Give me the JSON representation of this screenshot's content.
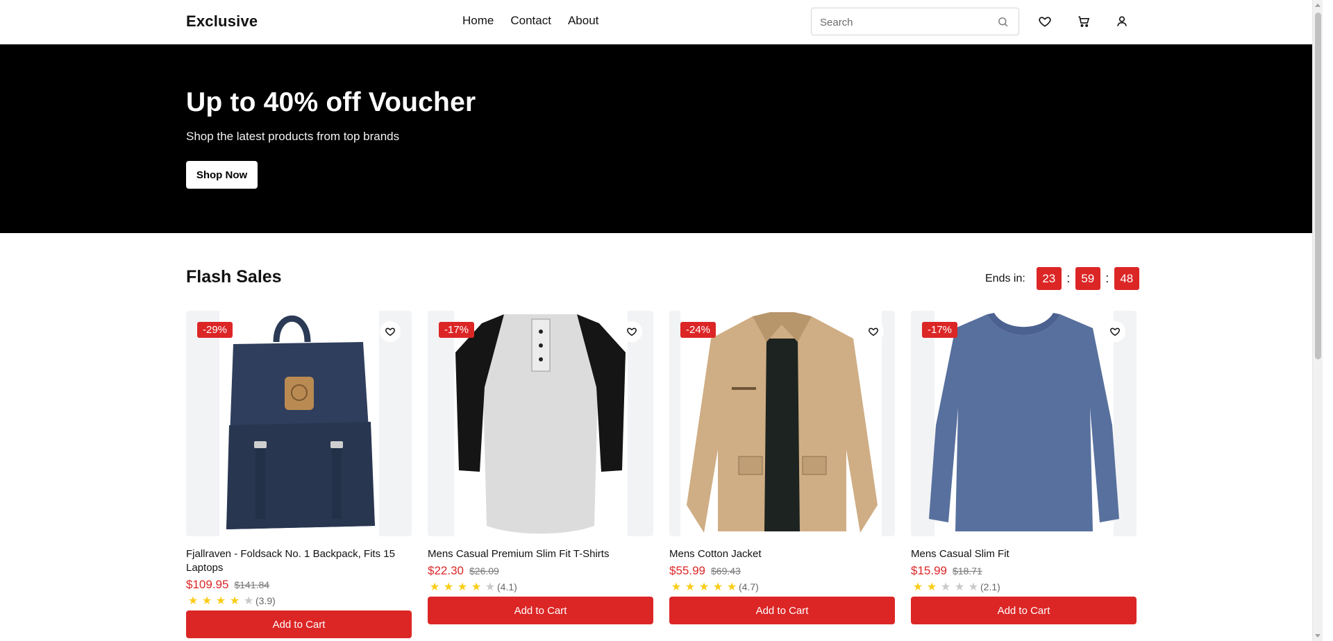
{
  "header": {
    "logo": "Exclusive",
    "nav": [
      "Home",
      "Contact",
      "About"
    ],
    "search_placeholder": "Search",
    "icons": [
      "heart-icon",
      "cart-icon",
      "user-icon"
    ]
  },
  "hero": {
    "title": "Up to 40% off Voucher",
    "subtitle": "Shop the latest products from top brands",
    "button": "Shop Now"
  },
  "flash_sales": {
    "title": "Flash Sales",
    "ends_label": "Ends in:",
    "timer": {
      "hours": "23",
      "minutes": "59",
      "seconds": "48",
      "separator": ":"
    }
  },
  "products": [
    {
      "name": "Fjallraven - Foldsack No. 1 Backpack, Fits 15 Laptops",
      "badge": "-29%",
      "price": "$109.95",
      "old_price": "$141.84",
      "rating": 3.9,
      "rating_text": "(3.9)",
      "button": "Add to Cart"
    },
    {
      "name": "Mens Casual Premium Slim Fit T-Shirts",
      "badge": "-17%",
      "price": "$22.30",
      "old_price": "$26.09",
      "rating": 4.1,
      "rating_text": "(4.1)",
      "button": "Add to Cart"
    },
    {
      "name": "Mens Cotton Jacket",
      "badge": "-24%",
      "price": "$55.99",
      "old_price": "$69.43",
      "rating": 4.7,
      "rating_text": "(4.7)",
      "button": "Add to Cart"
    },
    {
      "name": "Mens Casual Slim Fit",
      "badge": "-17%",
      "price": "$15.99",
      "old_price": "$18.71",
      "rating": 2.1,
      "rating_text": "(2.1)",
      "button": "Add to Cart"
    }
  ],
  "colors": {
    "accent": "#dc2626",
    "hero_bg": "#000000",
    "star": "#facc15"
  }
}
